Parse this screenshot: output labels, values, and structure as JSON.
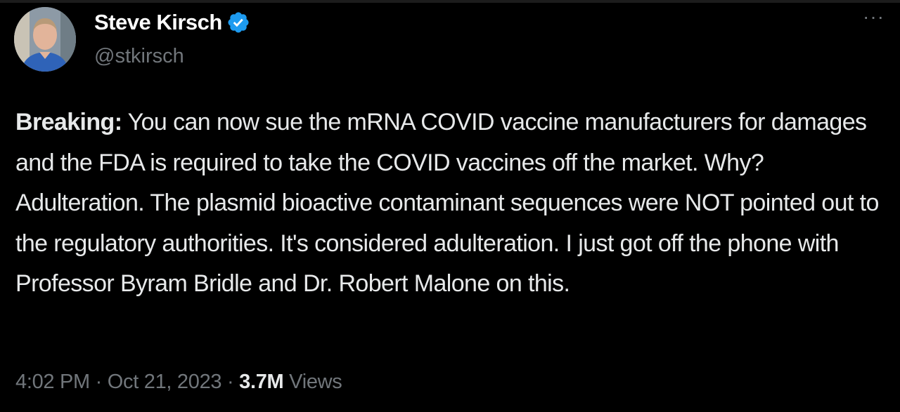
{
  "author": {
    "name": "Steve Kirsch",
    "handle": "@stkirsch",
    "verified": true,
    "verified_color": "#1d9bf0"
  },
  "more_icon": "ellipsis-icon",
  "tweet": {
    "lead": "Breaking:",
    "text": " You can now sue the mRNA COVID vaccine manufacturers for damages and the FDA is required to take the COVID vaccines off the market. Why? Adulteration. The plasmid bioactive contaminant sequences were NOT pointed out to the regulatory authorities. It's considered adulteration. I just got off the phone with Professor Byram Bridle and Dr. Robert Malone on this."
  },
  "meta": {
    "time": "4:02 PM",
    "date": "Oct 21, 2023",
    "views_count": "3.7M",
    "views_label": "Views"
  }
}
